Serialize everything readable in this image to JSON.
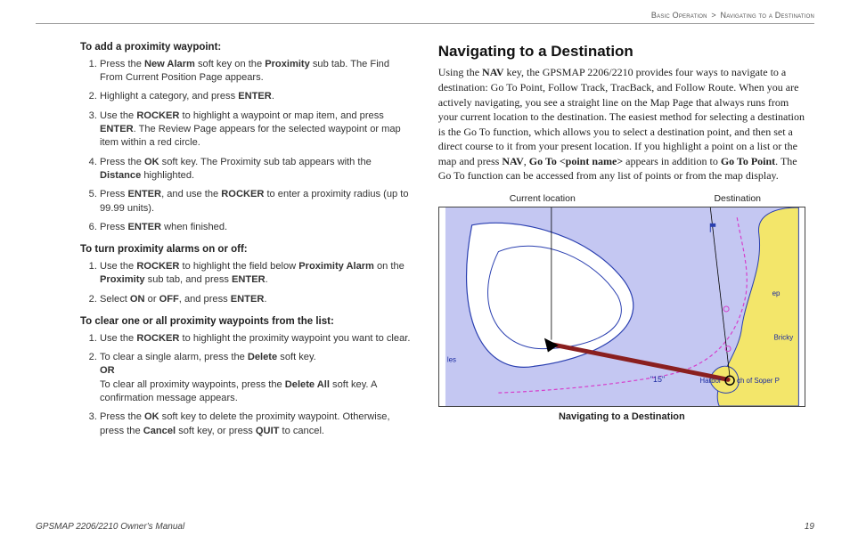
{
  "header": {
    "path_a": "Basic Operation",
    "sep": ">",
    "path_b": "Navigating to a Destination"
  },
  "left": {
    "proc1_head": "To add a proximity waypoint:",
    "proc1": [
      "Press the <b>New Alarm</b> soft key on the <b>Proximity</b> sub tab. The Find From Current Position Page appears.",
      "Highlight a category, and press <b>ENTER</b>.",
      "Use the <b>ROCKER</b> to highlight a waypoint or map item, and press <b>ENTER</b>. The Review Page appears for the selected waypoint or map item within a red circle.",
      "Press the <b>OK</b> soft key. The Proximity sub tab appears with the <b>Distance</b> highlighted.",
      "Press <b>ENTER</b>, and use the <b>ROCKER</b> to enter a proximity radius (up to 99.99 units).",
      "Press <b>ENTER</b> when finished."
    ],
    "proc2_head": "To turn proximity alarms on or off:",
    "proc2": [
      "Use the <b>ROCKER</b> to highlight the field below <b>Proximity Alarm</b> on the <b>Proximity</b> sub tab, and press <b>ENTER</b>.",
      "Select <b>ON</b> or <b>OFF</b>, and press <b>ENTER</b>."
    ],
    "proc3_head": "To clear one or all proximity waypoints from the list:",
    "proc3": [
      "Use the <b>ROCKER</b> to highlight the proximity waypoint you want to clear.",
      "To clear a single alarm, press the <b>Delete</b> soft key.<br><b>OR</b><br>To clear all proximity waypoints, press the <b>Delete All</b> soft key.  A confirmation message appears.",
      "Press the <b>OK</b> soft key to delete the proximity waypoint. Otherwise, press the <b>Cancel</b> soft key, or press <b>QUIT</b> to cancel."
    ]
  },
  "right": {
    "title": "Navigating to a Destination",
    "para": "Using the <b>NAV</b> key, the GPSMAP 2206/2210 provides four ways to navigate to a destination: Go To Point, Follow Track, TracBack, and Follow Route. When you are actively navigating, you see a straight line on the Map Page that always runs from your current location to the destination. The easiest method for selecting a destination is the Go To function, which allows you to select a destination point, and then set a direct course to it from your present location. If you highlight a point on a list or the map and press <b>NAV</b>, <b>Go To &lt;point name&gt;</b> appears in addition to <b>Go To Point</b>. The Go To function can be accessed from any list of points or from the map display.",
    "fig_label_a": "Current location",
    "fig_label_b": "Destination",
    "fig_caption": "Navigating to a Destination"
  },
  "map": {
    "colors": {
      "land": "#f3e66a",
      "shallow": "#c4c7f2",
      "deep": "#ffffff",
      "outline": "#2a3fb0",
      "route": "#8a1f1f",
      "magenta": "#d63ecb"
    },
    "depth_label": "\"15\"",
    "harbor_label": "Harbor",
    "port_labels": [
      "les",
      "Brickya",
      "ch of Soper P",
      "ep"
    ]
  },
  "footer": {
    "left": "GPSMAP 2206/2210 Owner's Manual",
    "right": "19"
  }
}
